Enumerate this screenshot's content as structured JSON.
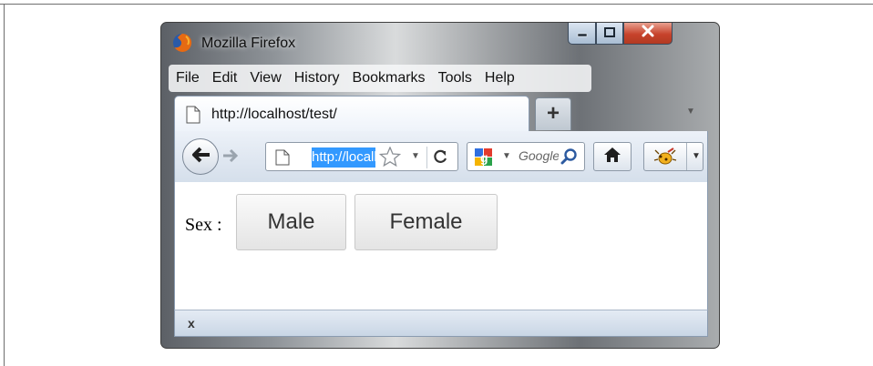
{
  "window": {
    "title": "Mozilla Firefox",
    "controls": {
      "minimize_icon": "minimize-icon",
      "maximize_icon": "maximize-icon",
      "close_icon": "close-icon"
    }
  },
  "menu": [
    {
      "label": "File"
    },
    {
      "label": "Edit"
    },
    {
      "label": "View"
    },
    {
      "label": "History"
    },
    {
      "label": "Bookmarks"
    },
    {
      "label": "Tools"
    },
    {
      "label": "Help"
    }
  ],
  "tabs": [
    {
      "label": "http://localhost/test/",
      "active": true
    }
  ],
  "new_tab_label": "+",
  "nav": {
    "url_value": "http://localhost/test/",
    "search_placeholder": "Google"
  },
  "content": {
    "sex_label": "Sex :",
    "options": [
      {
        "label": "Male"
      },
      {
        "label": "Female"
      }
    ]
  },
  "status": {
    "close_label": "x"
  },
  "colors": {
    "selection": "#3399ff",
    "close_button": "#c7432c",
    "toolbar": "#dfe6ef"
  }
}
